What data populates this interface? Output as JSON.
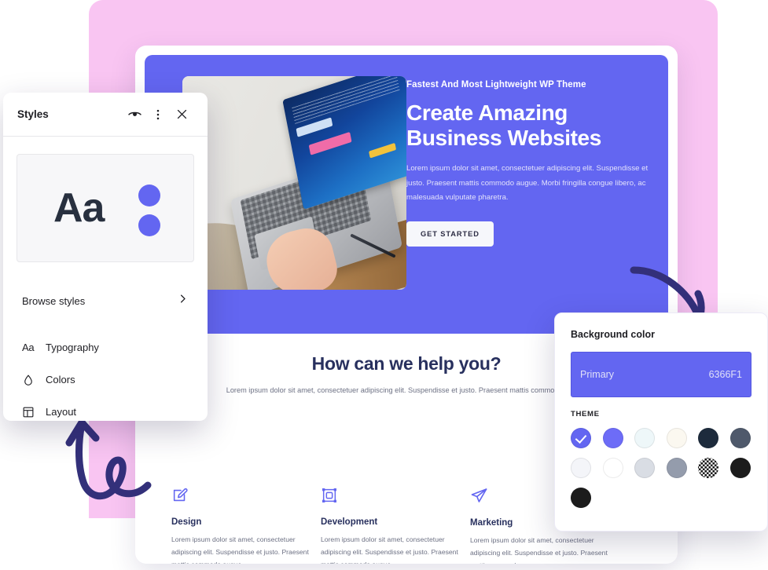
{
  "canvas": {
    "pink_background": "#f9c5f2",
    "accent": "#6366f1",
    "arrow_color": "#33307a"
  },
  "site": {
    "hero": {
      "eyebrow": "Fastest And Most Lightweight WP Theme",
      "title_line1": "Create Amazing",
      "title_line2": "Business Websites",
      "subtitle": "Lorem ipsum dolor sit amet, consectetuer adipiscing elit. Suspendisse et justo. Praesent mattis commodo augue. Morbi fringilla congue libero, ac malesuada vulputate pharetra.",
      "cta_label": "GET STARTED",
      "background_color": "#6366f1",
      "photo_alt": "laptop-on-desk-photo"
    },
    "help": {
      "title": "How can we help you?",
      "subtitle": "Lorem ipsum dolor sit amet, consectetuer adipiscing elit. Suspendisse et justo. Praesent mattis commodo augue."
    },
    "features": [
      {
        "icon": "pencil-square-icon",
        "title": "Design",
        "text": "Lorem ipsum dolor sit amet, consectetuer adipiscing elit. Suspendisse et justo. Praesent mattis commodo augue."
      },
      {
        "icon": "transform-object-icon",
        "title": "Development",
        "text": "Lorem ipsum dolor sit amet, consectetuer adipiscing elit. Suspendisse et justo. Praesent mattis commodo augue."
      },
      {
        "icon": "paper-plane-icon",
        "title": "Marketing",
        "text": "Lorem ipsum dolor sit amet, consectetuer adipiscing elit. Suspendisse et justo. Praesent mattis commodo augue."
      }
    ]
  },
  "styles_panel": {
    "title": "Styles",
    "header_icons": [
      "eye-icon",
      "more-vertical-icon",
      "close-icon"
    ],
    "preview": {
      "sample_text": "Aa",
      "dot_color": "#6366f1"
    },
    "browse_label": "Browse styles",
    "items": [
      {
        "icon": "typography-icon",
        "glyph": "Aa",
        "label": "Typography"
      },
      {
        "icon": "droplet-icon",
        "glyph": "",
        "label": "Colors"
      },
      {
        "icon": "layout-icon",
        "glyph": "",
        "label": "Layout"
      }
    ]
  },
  "background_panel": {
    "title": "Background color",
    "selected": {
      "name": "Primary",
      "hex": "6366F1",
      "color": "#6366f1"
    },
    "theme_label": "THEME",
    "swatches": [
      {
        "color": "#6366f1",
        "selected": true,
        "transparent": false
      },
      {
        "color": "#6d6cf7",
        "selected": false,
        "transparent": false
      },
      {
        "color": "#eef7f9",
        "selected": false,
        "transparent": false
      },
      {
        "color": "#fbf8f0",
        "selected": false,
        "transparent": false
      },
      {
        "color": "#1d2b3c",
        "selected": false,
        "transparent": false
      },
      {
        "color": "#4f596b",
        "selected": false,
        "transparent": false
      },
      {
        "color": "#f4f5f9",
        "selected": false,
        "transparent": false
      },
      {
        "color": "#ffffff",
        "selected": false,
        "transparent": false
      },
      {
        "color": "#d9dde4",
        "selected": false,
        "transparent": false
      },
      {
        "color": "#949cac",
        "selected": false,
        "transparent": false
      },
      {
        "color": "transparent",
        "selected": false,
        "transparent": true
      },
      {
        "color": "#1c1c1c",
        "selected": false,
        "transparent": false
      },
      {
        "color": "#1c1c1c",
        "selected": false,
        "transparent": false
      }
    ]
  }
}
